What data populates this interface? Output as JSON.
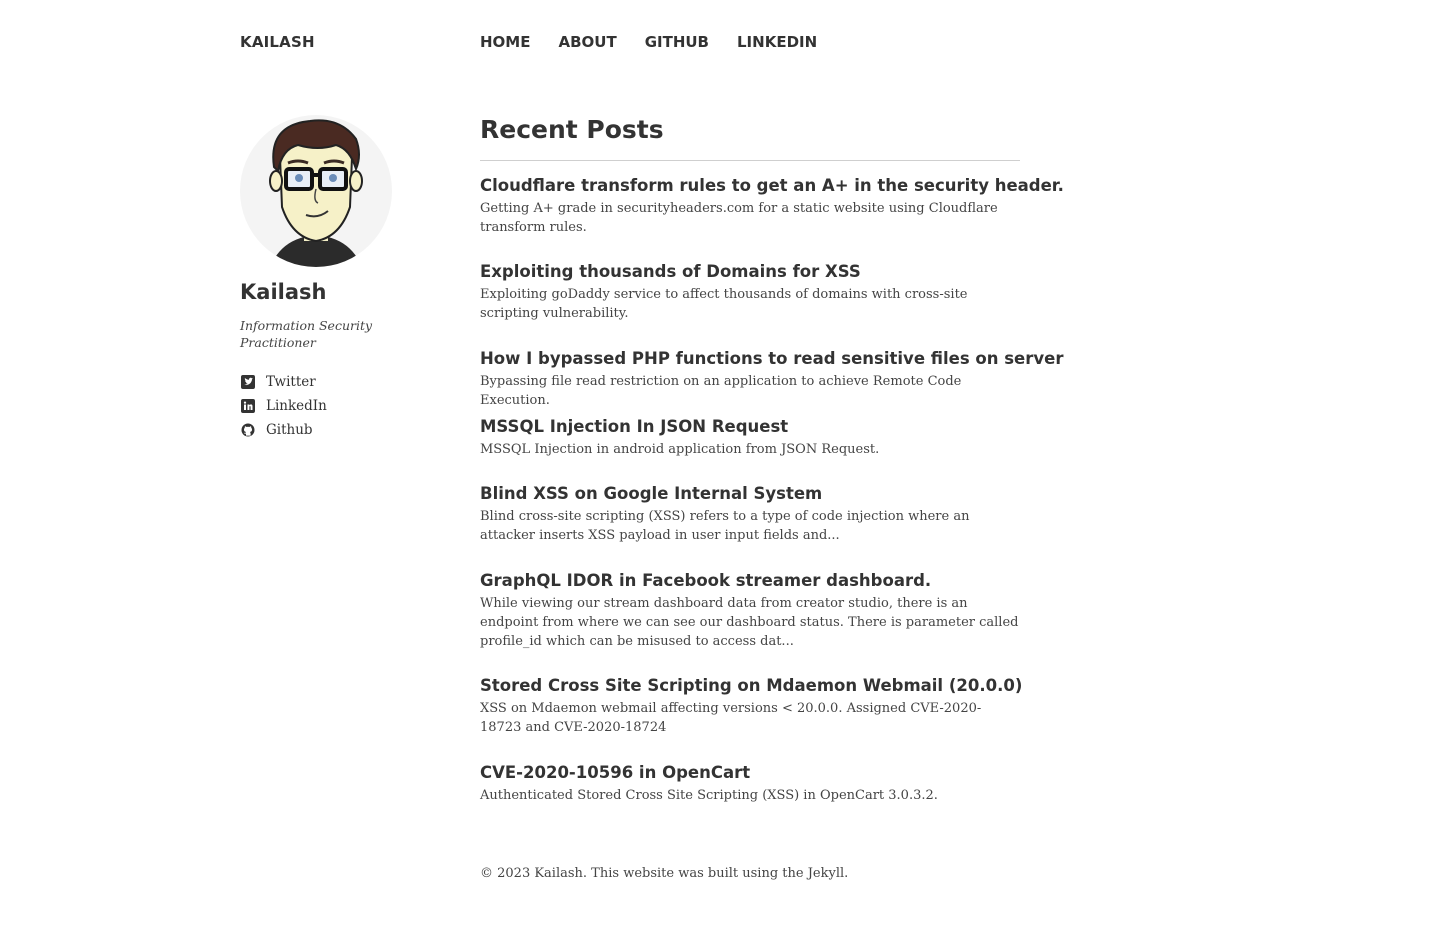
{
  "site": {
    "title": "KAILASH"
  },
  "nav": {
    "items": [
      "HOME",
      "ABOUT",
      "GITHUB",
      "LINKEDIN"
    ]
  },
  "sidebar": {
    "name": "Kailash",
    "bio": "Information Security Practitioner",
    "links": [
      {
        "label": "Twitter",
        "icon": "twitter-icon"
      },
      {
        "label": "LinkedIn",
        "icon": "linkedin-icon"
      },
      {
        "label": "Github",
        "icon": "github-icon"
      }
    ]
  },
  "main": {
    "heading": "Recent Posts",
    "posts": [
      {
        "title": "Cloudflare transform rules to get an A+ in the security header.",
        "excerpt": "Getting A+ grade in securityheaders.com for a static website using Cloudflare transform rules."
      },
      {
        "title": "Exploiting thousands of Domains for XSS",
        "excerpt": "Exploiting goDaddy service to affect thousands of domains with cross-site scripting vulnerability."
      },
      {
        "title": "How I bypassed PHP functions to read sensitive files on server",
        "excerpt": "Bypassing file read restriction on an application to achieve Remote Code Execution."
      },
      {
        "title": "MSSQL Injection In JSON Request",
        "excerpt": "MSSQL Injection in android application from JSON Request."
      },
      {
        "title": "Blind XSS on Google Internal System",
        "excerpt": "Blind cross-site scripting (XSS) refers to a type of code injection where an attacker inserts XSS payload in user input fields and..."
      },
      {
        "title": "GraphQL IDOR in Facebook streamer dashboard.",
        "excerpt": "While viewing our stream dashboard data from creator studio, there is an endpoint from where we can see our dashboard status. There is parameter called profile_id which can be misused to access dat..."
      },
      {
        "title": "Stored Cross Site Scripting on Mdaemon Webmail (20.0.0)",
        "excerpt": "XSS on Mdaemon webmail affecting versions < 20.0.0. Assigned CVE-2020-18723 and CVE-2020-18724"
      },
      {
        "title": "CVE-2020-10596 in OpenCart",
        "excerpt": "Authenticated Stored Cross Site Scripting (XSS) in OpenCart 3.0.3.2."
      }
    ]
  },
  "footer": {
    "text": "© 2023 Kailash. This website was built using the Jekyll."
  }
}
